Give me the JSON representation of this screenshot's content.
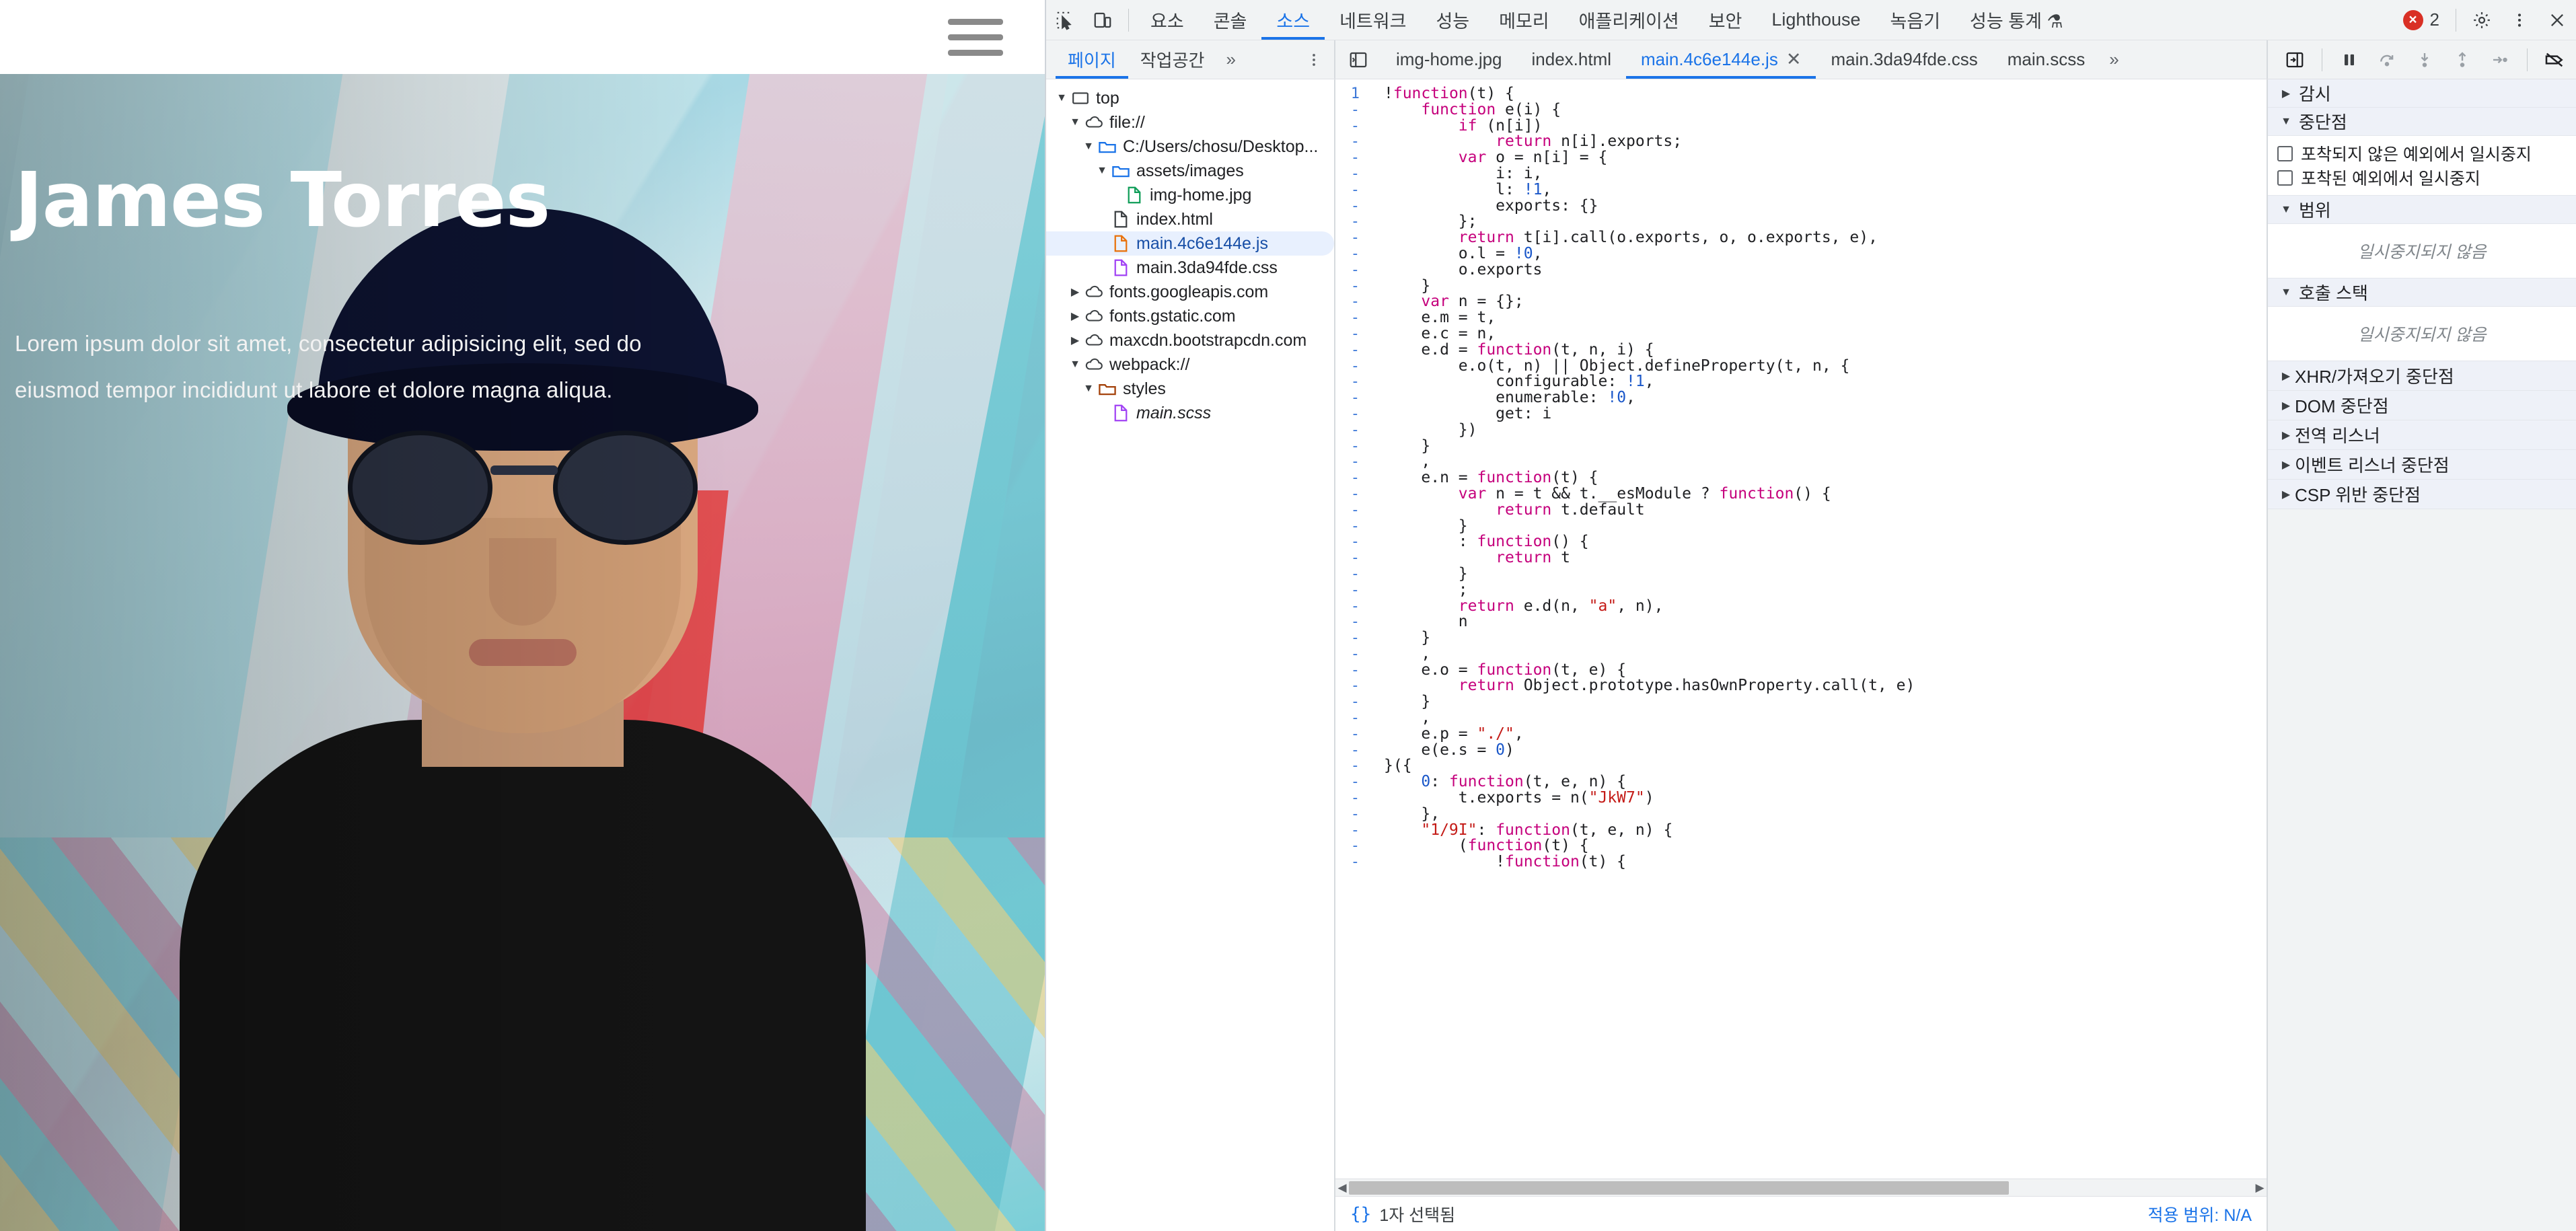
{
  "webpage": {
    "nav": {
      "menu_label": "hamburger-menu"
    },
    "hero": {
      "title": "James Torres",
      "subtitle": "Lorem ipsum dolor sit amet, consectetur adipisicing elit, sed do eiusmod tempor incididunt ut labore et dolore magna aliqua."
    }
  },
  "devtools": {
    "main_tabs": [
      {
        "label": "요소",
        "active": false
      },
      {
        "label": "콘솔",
        "active": false
      },
      {
        "label": "소스",
        "active": true
      },
      {
        "label": "네트워크",
        "active": false
      },
      {
        "label": "성능",
        "active": false
      },
      {
        "label": "메모리",
        "active": false
      },
      {
        "label": "애플리케이션",
        "active": false
      },
      {
        "label": "보안",
        "active": false
      },
      {
        "label": "Lighthouse",
        "active": false
      },
      {
        "label": "녹음기",
        "active": false
      },
      {
        "label": "성능 통계 ⚗",
        "active": false
      }
    ],
    "errors": {
      "count": "2",
      "color": "#d93025"
    },
    "navigator_tabs": [
      {
        "label": "페이지",
        "active": true
      },
      {
        "label": "작업공간",
        "active": false
      }
    ],
    "navigator_more": "»",
    "file_tabs": [
      {
        "label": "img-home.jpg",
        "active": false,
        "closable": false
      },
      {
        "label": "index.html",
        "active": false,
        "closable": false
      },
      {
        "label": "main.4c6e144e.js",
        "active": true,
        "closable": true
      },
      {
        "label": "main.3da94fde.css",
        "active": false,
        "closable": false
      },
      {
        "label": "main.scss",
        "active": false,
        "closable": false
      }
    ],
    "file_tabs_more": "»",
    "tree": [
      {
        "label": "top",
        "depth": 0,
        "twisty": "open",
        "icon": "frame",
        "selected": false,
        "italic": false
      },
      {
        "label": "file://",
        "depth": 1,
        "twisty": "open",
        "icon": "cloud",
        "selected": false,
        "italic": false
      },
      {
        "label": "C:/Users/chosu/Desktop...",
        "depth": 2,
        "twisty": "open",
        "icon": "folder-blue",
        "selected": false,
        "italic": false
      },
      {
        "label": "assets/images",
        "depth": 3,
        "twisty": "open",
        "icon": "folder-blue",
        "selected": false,
        "italic": false
      },
      {
        "label": "img-home.jpg",
        "depth": 4,
        "twisty": "none",
        "icon": "file-green",
        "selected": false,
        "italic": false
      },
      {
        "label": "index.html",
        "depth": 3,
        "twisty": "none",
        "icon": "file-gray",
        "selected": false,
        "italic": false
      },
      {
        "label": "main.4c6e144e.js",
        "depth": 3,
        "twisty": "none",
        "icon": "file-orange",
        "selected": true,
        "italic": false
      },
      {
        "label": "main.3da94fde.css",
        "depth": 3,
        "twisty": "none",
        "icon": "file-purple",
        "selected": false,
        "italic": false
      },
      {
        "label": "fonts.googleapis.com",
        "depth": 1,
        "twisty": "closed",
        "icon": "cloud",
        "selected": false,
        "italic": false
      },
      {
        "label": "fonts.gstatic.com",
        "depth": 1,
        "twisty": "closed",
        "icon": "cloud",
        "selected": false,
        "italic": false
      },
      {
        "label": "maxcdn.bootstrapcdn.com",
        "depth": 1,
        "twisty": "closed",
        "icon": "cloud",
        "selected": false,
        "italic": false
      },
      {
        "label": "webpack://",
        "depth": 1,
        "twisty": "open",
        "icon": "cloud",
        "selected": false,
        "italic": false
      },
      {
        "label": "styles",
        "depth": 2,
        "twisty": "open",
        "icon": "folder-brown",
        "selected": false,
        "italic": false
      },
      {
        "label": "main.scss",
        "depth": 3,
        "twisty": "none",
        "icon": "file-purple",
        "selected": false,
        "italic": true
      }
    ],
    "code": {
      "first_line_number": "1",
      "continuation_marker": "-",
      "lines": [
        "!function(t) {",
        "    function e(i) {",
        "        if (n[i])",
        "            return n[i].exports;",
        "        var o = n[i] = {",
        "            i: i,",
        "            l: !1,",
        "            exports: {}",
        "        };",
        "        return t[i].call(o.exports, o, o.exports, e),",
        "        o.l = !0,",
        "        o.exports",
        "    }",
        "    var n = {};",
        "    e.m = t,",
        "    e.c = n,",
        "    e.d = function(t, n, i) {",
        "        e.o(t, n) || Object.defineProperty(t, n, {",
        "            configurable: !1,",
        "            enumerable: !0,",
        "            get: i",
        "        })",
        "    }",
        "    ,",
        "    e.n = function(t) {",
        "        var n = t && t.__esModule ? function() {",
        "            return t.default",
        "        }",
        "        : function() {",
        "            return t",
        "        }",
        "        ;",
        "        return e.d(n, \"a\", n),",
        "        n",
        "    }",
        "    ,",
        "    e.o = function(t, e) {",
        "        return Object.prototype.hasOwnProperty.call(t, e)",
        "    }",
        "    ,",
        "    e.p = \"./\",",
        "    e(e.s = 0)",
        "}({",
        "    0: function(t, e, n) {",
        "        t.exports = n(\"JkW7\")",
        "    },",
        "    \"1/9I\": function(t, e, n) {",
        "        (function(t) {",
        "            !function(t) {"
      ]
    },
    "status": {
      "icon": "{}",
      "selection_text": "1자 선택됨",
      "coverage_label": "적용 범위: N/A"
    },
    "debugger_sidebar": {
      "sections": [
        {
          "label": "감시",
          "twisty": "closed",
          "type": "section"
        },
        {
          "label": "중단점",
          "twisty": "open",
          "type": "section"
        },
        {
          "label": "포착되지 않은 예외에서 일시중지",
          "type": "checkbox",
          "checked": false
        },
        {
          "label": "포착된 예외에서 일시중지",
          "type": "checkbox",
          "checked": false
        },
        {
          "label": "범위",
          "twisty": "open",
          "type": "section"
        },
        {
          "label": "일시중지되지 않음",
          "type": "note"
        },
        {
          "label": "호출 스택",
          "twisty": "open",
          "type": "section"
        },
        {
          "label": "일시중지되지 않음",
          "type": "note"
        },
        {
          "label": "XHR/가져오기 중단점",
          "twisty": "closed",
          "type": "row"
        },
        {
          "label": "DOM 중단점",
          "twisty": "closed",
          "type": "row"
        },
        {
          "label": "전역 리스너",
          "twisty": "closed",
          "type": "row"
        },
        {
          "label": "이벤트 리스너 중단점",
          "twisty": "closed",
          "type": "row"
        },
        {
          "label": "CSP 위반 중단점",
          "twisty": "closed",
          "type": "row"
        }
      ]
    },
    "colors": {
      "accent": "#1a73e8",
      "error": "#d93025",
      "panel_bg": "#f1f3f4",
      "selected_bg": "#e8f0fe"
    }
  }
}
